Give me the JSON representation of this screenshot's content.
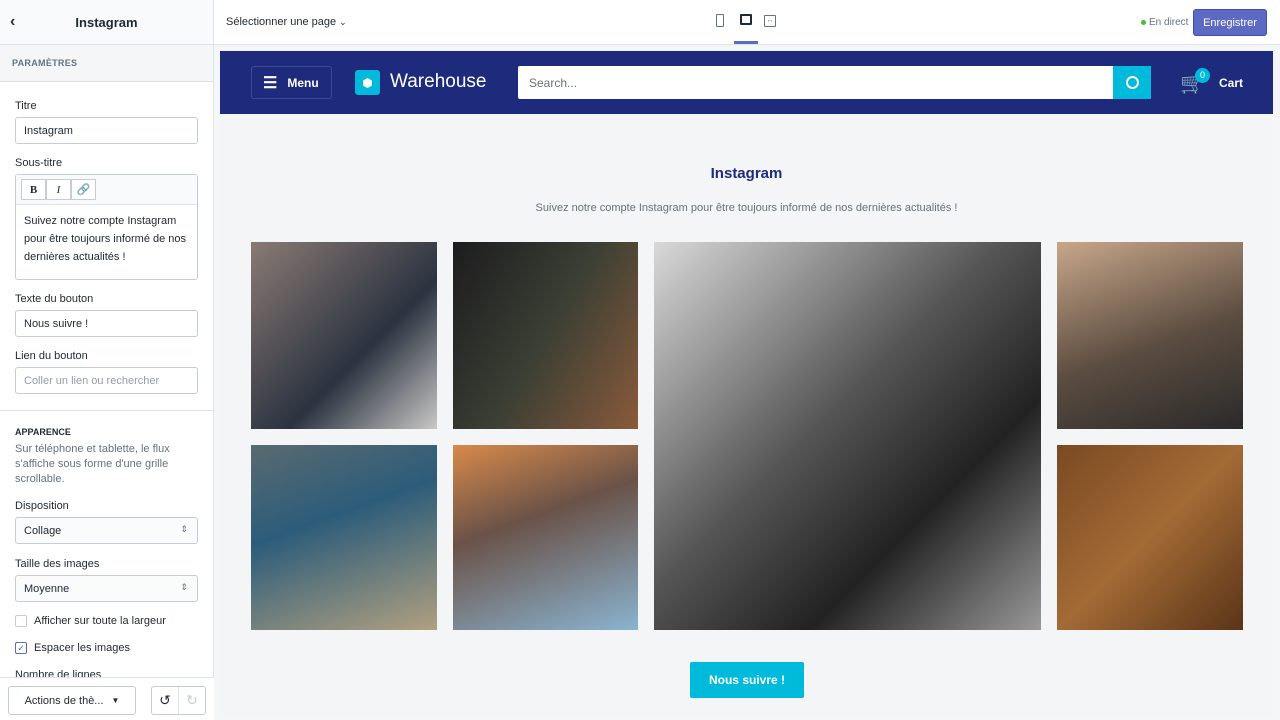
{
  "sidebar": {
    "title": "Instagram",
    "section": "PARAMÈTRES",
    "title_label": "Titre",
    "title_value": "Instagram",
    "subtitle_label": "Sous-titre",
    "subtitle_value": "Suivez notre compte Instagram pour être toujours informé de nos dernières actualités !",
    "button_text_label": "Texte du bouton",
    "button_text_value": "Nous suivre !",
    "button_link_label": "Lien du bouton",
    "button_link_placeholder": "Coller un lien ou rechercher",
    "appearance": "APPARENCE",
    "appearance_help": "Sur téléphone et tablette, le flux s'affiche sous forme d'une grille scrollable.",
    "layout_label": "Disposition",
    "layout_value": "Collage",
    "size_label": "Taille des images",
    "size_value": "Moyenne",
    "fullwidth_label": "Afficher sur toute la largeur",
    "fullwidth_checked": false,
    "spacing_label": "Espacer les images",
    "spacing_checked": true,
    "rows_label": "Nombre de lignes",
    "actions": "Actions de thè..."
  },
  "topbar": {
    "page_select": "Sélectionner une page",
    "status": "En direct",
    "save": "Enregistrer",
    "active_view": "desktop"
  },
  "store": {
    "menu": "Menu",
    "brand": "Warehouse",
    "search_placeholder": "Search...",
    "cart_count": "0",
    "cart": "Cart",
    "heading": "Instagram",
    "subheading": "Suivez notre compte Instagram pour être toujours informé de nos dernières actualités !",
    "follow": "Nous suivre !"
  },
  "colors": {
    "navy": "#1e2a7b",
    "accent": "#00badb",
    "primary": "#5c6ac4",
    "live": "#50b83c"
  }
}
